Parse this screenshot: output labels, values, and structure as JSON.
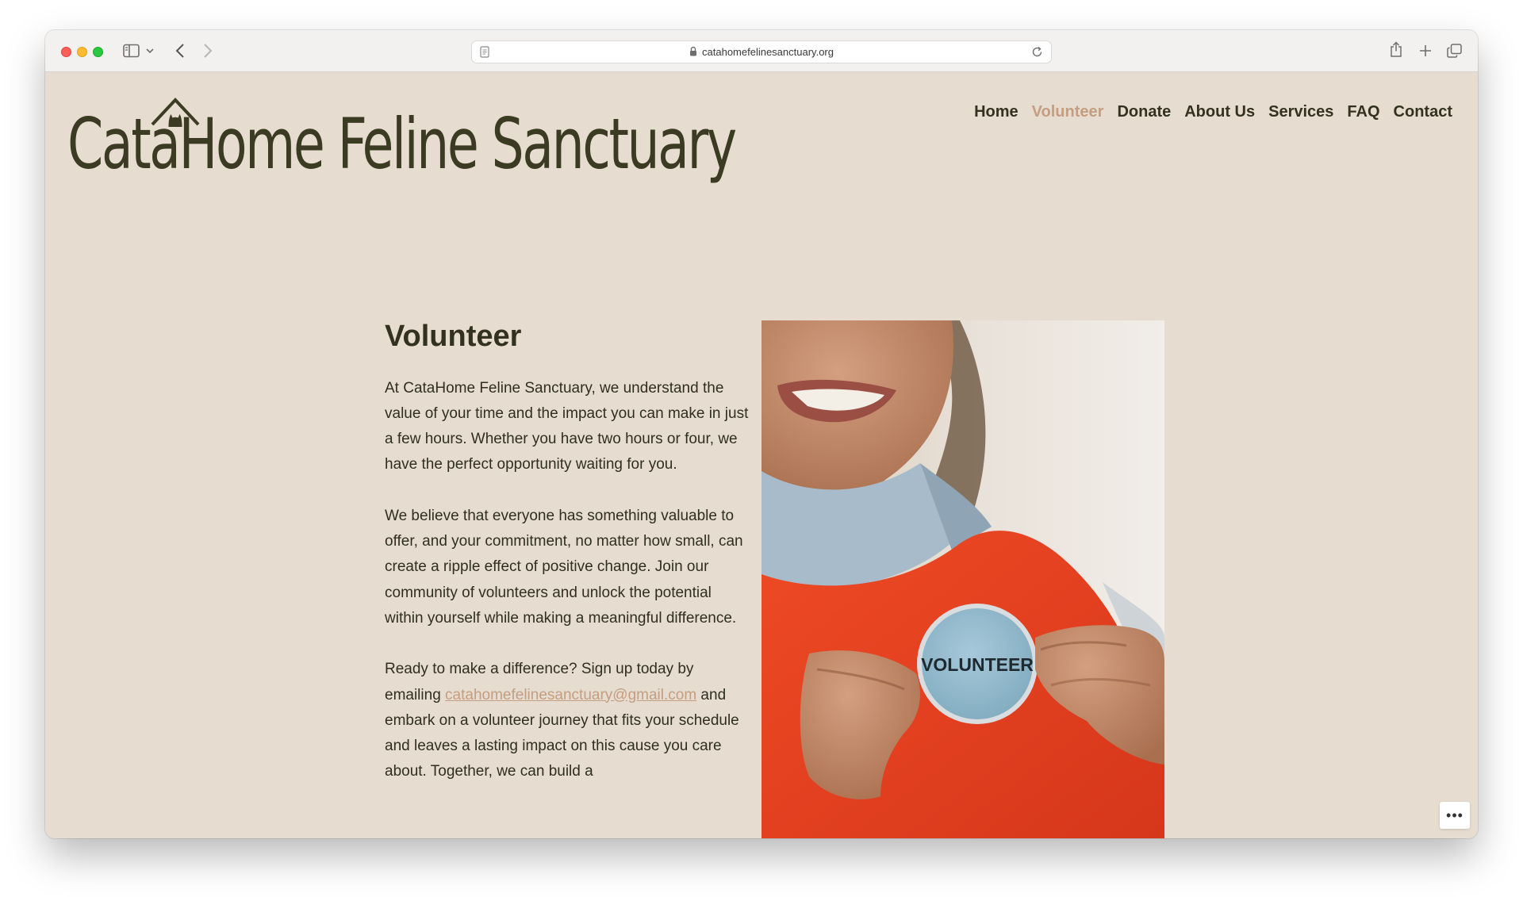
{
  "browser": {
    "url": "catahomefelinesanctuary.org"
  },
  "site": {
    "title": "CataHome Feline Sanctuary",
    "nav": [
      {
        "label": "Home",
        "active": false
      },
      {
        "label": "Volunteer",
        "active": true
      },
      {
        "label": "Donate",
        "active": false
      },
      {
        "label": "About Us",
        "active": false
      },
      {
        "label": "Services",
        "active": false
      },
      {
        "label": "FAQ",
        "active": false
      },
      {
        "label": "Contact",
        "active": false
      }
    ]
  },
  "content": {
    "heading": "Volunteer",
    "paragraph1": "At CataHome Feline Sanctuary, we understand the value of your time and the impact you can make in just a few hours. Whether you have two hours or four, we have the perfect opportunity waiting for you.",
    "paragraph2": "We believe that everyone has something valuable to offer, and your commitment, no matter how small, can create a ripple effect of positive change. Join our community of volunteers and unlock the potential within yourself while making a meaningful difference.",
    "paragraph3_before": "Ready to make a difference? Sign up today by emailing ",
    "email": "catahomefelinesanctuary@gmail.com",
    "paragraph3_after": " and embark on a volunteer journey that fits your schedule and leaves a lasting impact on this cause you care about. Together, we can build a",
    "photo_badge_text": "VOLUNTEER"
  },
  "colors": {
    "page_bg": "#e6ddd0",
    "text_dark": "#33311f",
    "accent": "#c59d80",
    "shirt_red": "#e43d1c",
    "badge_blue": "#8fb7cb"
  },
  "icons": {
    "sidebar": "sidebar-icon",
    "back": "chevron-left-icon",
    "forward": "chevron-right-icon",
    "lock": "lock-icon",
    "reload": "reload-icon",
    "share": "share-icon",
    "new_tab": "plus-icon",
    "tabs": "tabs-icon",
    "more": "more-icon"
  }
}
